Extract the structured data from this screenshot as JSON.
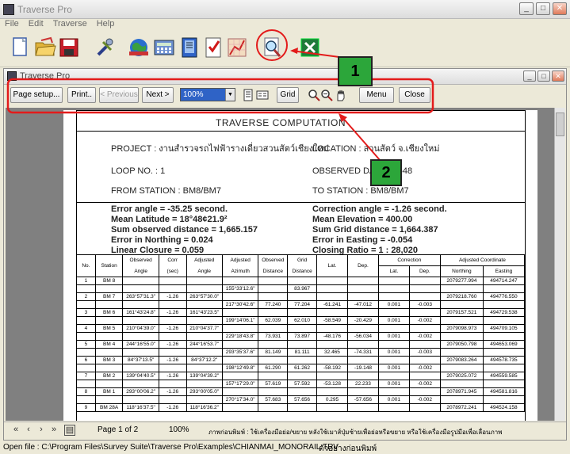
{
  "window": {
    "title": "Traverse Pro"
  },
  "menu": [
    "File",
    "Edit",
    "Traverse",
    "Help"
  ],
  "toolbar_icons": [
    "new-file-icon",
    "open-folder-icon",
    "save-icon",
    "tools-icon",
    "world-map-icon",
    "calculator-icon",
    "phone-book-icon",
    "checklist-icon",
    "traverse-diagram-icon",
    "print-preview-icon",
    "excel-icon"
  ],
  "child": {
    "title": "Traverse Pro",
    "buttons": {
      "page_setup": "Page setup...",
      "print": "Print..",
      "previous": "< Previous",
      "next": "Next >",
      "grid": "Grid",
      "menu": "Menu",
      "close": "Close"
    },
    "zoom": "100%"
  },
  "report": {
    "title": "TRAVERSE COMPUTATION",
    "project": "PROJECT : งานสำรวจรถไฟฟ้ารางเดี่ยวสวนสัตว์เชียงใหม่",
    "location": "LOCATION : สวนสัตว์ จ.เชียงใหม่",
    "loop": "LOOP NO. : 1",
    "observed_date": "OBSERVED DATE : 2548",
    "from_station": "FROM STATION : BM8/BM7",
    "to_station": "TO STATION : BM8/BM7",
    "summary_left": [
      "Error angle = -35.25 second.",
      "Mean Latitude = 18°48¢21.9²",
      "Sum observed distance = 1,665.157",
      "Error in Northing = 0.024",
      "Linear Closure = 0.059"
    ],
    "summary_right": [
      "Correction angle = -1.26 second.",
      "Mean Elevation = 400.00",
      "Sum Grid distance = 1,664.387",
      "Error in Easting = -0.054",
      "Closing Ratio = 1 : 28,020"
    ],
    "table_headers": {
      "no": "No.",
      "station": "Station",
      "observed_angle": [
        "Observed",
        "Angle"
      ],
      "corr": [
        "Corr",
        "(sec)"
      ],
      "adjusted_angle": [
        "Adjusted",
        "Angle"
      ],
      "adjusted_azimuth": [
        "Adjusted",
        "Azimuth"
      ],
      "observed_distance": [
        "Observed",
        "Distance"
      ],
      "grid_distance": [
        "Grid",
        "Distance"
      ],
      "lat": "Lat.",
      "dep": "Dep.",
      "correction": "Correction",
      "adjusted_coordinate": "Adjusted Coordinate",
      "corr_lat": "Lat.",
      "corr_dep": "Dep.",
      "northing": "Northing",
      "easting": "Easting"
    },
    "rows": [
      {
        "type": "st",
        "no": "1",
        "station": "BM 8",
        "obs": "",
        "corr": "",
        "adj": "",
        "north": "2079277.994",
        "east": "494714.247"
      },
      {
        "type": "leg",
        "az": "155°33'12.6\"",
        "od": "",
        "gd": "83.967",
        "lat": "",
        "dep": "",
        "clat": "",
        "cdep": ""
      },
      {
        "type": "st",
        "no": "2",
        "station": "BM 7",
        "obs": "263°57'31.3\"",
        "corr": "-1.26",
        "adj": "263°57'30.0\"",
        "north": "2079218.760",
        "east": "494776.550"
      },
      {
        "type": "leg",
        "az": "217°30'42.6\"",
        "od": "77.240",
        "gd": "77.204",
        "lat": "-61.241",
        "dep": "-47.012",
        "clat": "0.001",
        "cdep": "-0.003"
      },
      {
        "type": "st",
        "no": "3",
        "station": "BM 6",
        "obs": "161°43'24.8\"",
        "corr": "-1.26",
        "adj": "161°43'23.5\"",
        "north": "2079157.521",
        "east": "494729.538"
      },
      {
        "type": "leg",
        "az": "199°14'06.1\"",
        "od": "62.039",
        "gd": "62.010",
        "lat": "-58.549",
        "dep": "-20.429",
        "clat": "0.001",
        "cdep": "-0.002"
      },
      {
        "type": "st",
        "no": "4",
        "station": "BM 5",
        "obs": "210°04'39.0\"",
        "corr": "-1.26",
        "adj": "210°04'37.7\"",
        "north": "2079098.973",
        "east": "494709.105"
      },
      {
        "type": "leg",
        "az": "229°18'43.8\"",
        "od": "73.931",
        "gd": "73.897",
        "lat": "-48.176",
        "dep": "-56.034",
        "clat": "0.001",
        "cdep": "-0.002"
      },
      {
        "type": "st",
        "no": "5",
        "station": "BM 4",
        "obs": "244°16'55.0\"",
        "corr": "-1.26",
        "adj": "244°16'53.7\"",
        "north": "2079050.798",
        "east": "494653.069"
      },
      {
        "type": "leg",
        "az": "293°35'37.6\"",
        "od": "81.149",
        "gd": "81.111",
        "lat": "32.465",
        "dep": "-74.331",
        "clat": "0.001",
        "cdep": "-0.003"
      },
      {
        "type": "st",
        "no": "6",
        "station": "BM 3",
        "obs": "84°37'13.5\"",
        "corr": "-1.26",
        "adj": "84°37'12.2\"",
        "north": "2079083.264",
        "east": "494578.735"
      },
      {
        "type": "leg",
        "az": "198°12'49.8\"",
        "od": "61.290",
        "gd": "61.262",
        "lat": "-58.192",
        "dep": "-19.148",
        "clat": "0.001",
        "cdep": "-0.002"
      },
      {
        "type": "st",
        "no": "7",
        "station": "BM 2",
        "obs": "139°04'40.5\"",
        "corr": "-1.26",
        "adj": "139°04'39.2\"",
        "north": "2079025.072",
        "east": "494559.585"
      },
      {
        "type": "leg",
        "az": "157°17'29.0\"",
        "od": "57.619",
        "gd": "57.592",
        "lat": "-53.128",
        "dep": "22.233",
        "clat": "0.001",
        "cdep": "-0.002"
      },
      {
        "type": "st",
        "no": "8",
        "station": "BM 1",
        "obs": "293°00'06.2\"",
        "corr": "-1.26",
        "adj": "293°00'05.0\"",
        "north": "2078971.945",
        "east": "494581.816"
      },
      {
        "type": "leg",
        "az": "270°17'34.0\"",
        "od": "57.683",
        "gd": "57.656",
        "lat": "0.295",
        "dep": "-57.656",
        "clat": "0.001",
        "cdep": "-0.002"
      },
      {
        "type": "st",
        "no": "9",
        "station": "BM 28A",
        "obs": "118°16'37.5\"",
        "corr": "-1.26",
        "adj": "118°16'36.2\"",
        "north": "2078972.241",
        "east": "494524.158"
      }
    ]
  },
  "nav": {
    "page": "Page 1 of 2",
    "zoom": "100%",
    "hint": "ภาพก่อนพิมพ์ : ใช้เครื่องมือย่อ/ขยาย หลังใช้เมาส์ปุ่มซ้ายเพื่อย่อหรือขยาย หรือใช้เครื่องมือรูปมือเพื่อเลื่อนภาพ"
  },
  "status": {
    "open_file": "Open file : C:\\Program Files\\Survey Suite\\Traverse Pro\\Examples\\CHIANMAI_MONORAIL.TRV",
    "sample": "ตัวอย่างก่อนพิมพ์"
  },
  "callouts": [
    "1",
    "2"
  ],
  "colors": {
    "highlight": "#e31b1b",
    "callout": "#2ca63a",
    "zoom_select": "#2f63c6"
  }
}
